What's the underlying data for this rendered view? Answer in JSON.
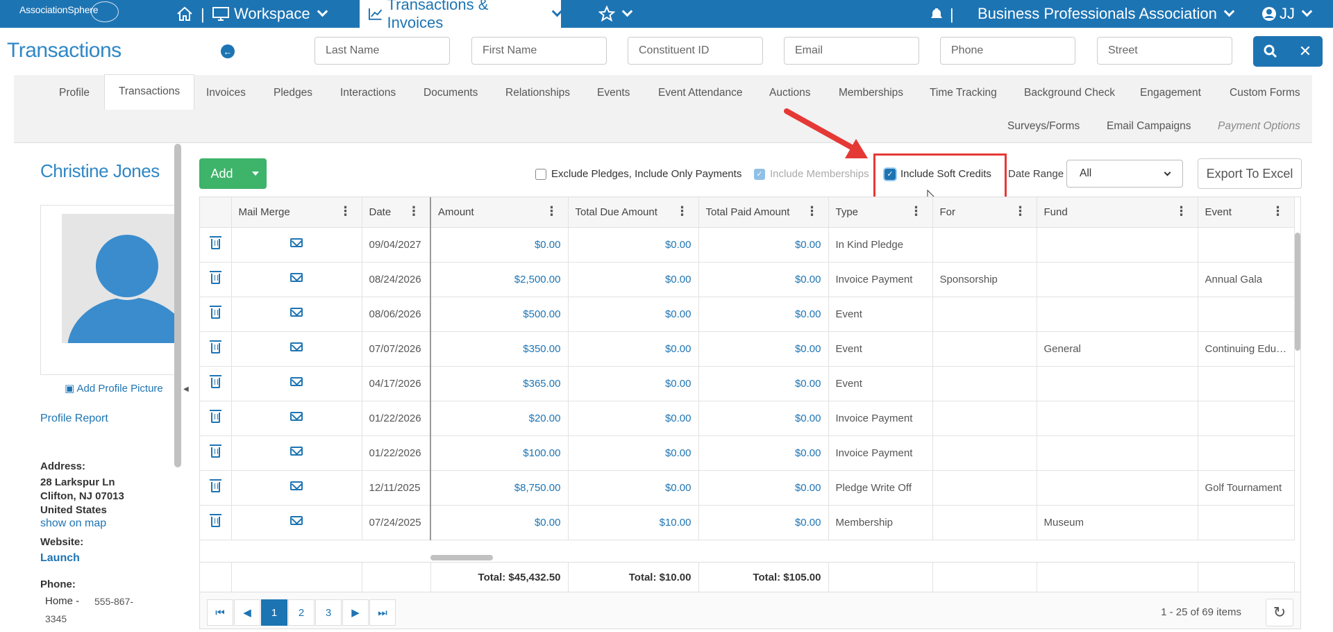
{
  "topbar": {
    "logo": "AssociationSphere",
    "sep": "|",
    "workspace": "Workspace",
    "active_tab": "Transactions & Invoices",
    "org": "Business Professionals Association",
    "user_initials": "JJ"
  },
  "header": {
    "title": "Transactions",
    "search_fields": [
      {
        "placeholder": "Last Name"
      },
      {
        "placeholder": "First Name"
      },
      {
        "placeholder": "Constituent ID"
      },
      {
        "placeholder": "Email"
      },
      {
        "placeholder": "Phone"
      },
      {
        "placeholder": "Street"
      }
    ]
  },
  "tabs": {
    "row1": [
      "Profile",
      "Transactions",
      "Invoices",
      "Pledges",
      "Interactions",
      "Documents",
      "Relationships",
      "Events",
      "Event Attendance",
      "Auctions",
      "Memberships",
      "Time Tracking",
      "Background Check",
      "Engagement",
      "Custom Forms"
    ],
    "row2": [
      "Surveys/Forms",
      "Email Campaigns",
      "Payment Options"
    ]
  },
  "profile": {
    "name": "Christine Jones",
    "add_picture": "Add Profile Picture",
    "report": "Profile Report",
    "address_label": "Address:",
    "address_line1": "28 Larkspur Ln",
    "address_line2": "Clifton, NJ 07013",
    "address_line3": "United States",
    "show_on_map": "show on map",
    "website_label": "Website:",
    "website_link": "Launch",
    "phone_label": "Phone:",
    "phone_type": "Home -",
    "phone_part1": "555-867-",
    "phone_part2": "3345"
  },
  "toolbar": {
    "add_label": "Add",
    "exclude_pledges": "Exclude Pledges, Include Only Payments",
    "include_memberships": "Include Memberships",
    "include_soft_credits": "Include Soft Credits",
    "date_range_label": "Date Range",
    "date_range_value": "All",
    "export_label": "Export To Excel"
  },
  "grid": {
    "columns": [
      "Mail Merge",
      "Date",
      "Amount",
      "Total Due Amount",
      "Total Paid Amount",
      "Type",
      "For",
      "Fund",
      "Event"
    ],
    "rows": [
      {
        "date": "09/04/2027",
        "amount": "$0.00",
        "due": "$0.00",
        "paid": "$0.00",
        "type": "In Kind Pledge",
        "for": "",
        "fund": "",
        "event": ""
      },
      {
        "date": "08/24/2026",
        "amount": "$2,500.00",
        "due": "$0.00",
        "paid": "$0.00",
        "type": "Invoice Payment",
        "for": "Sponsorship",
        "fund": "",
        "event": "Annual Gala"
      },
      {
        "date": "08/06/2026",
        "amount": "$500.00",
        "due": "$0.00",
        "paid": "$0.00",
        "type": "Event",
        "for": "",
        "fund": "",
        "event": ""
      },
      {
        "date": "07/07/2026",
        "amount": "$350.00",
        "due": "$0.00",
        "paid": "$0.00",
        "type": "Event",
        "for": "",
        "fund": "General",
        "event": "Continuing Educa..."
      },
      {
        "date": "04/17/2026",
        "amount": "$365.00",
        "due": "$0.00",
        "paid": "$0.00",
        "type": "Event",
        "for": "",
        "fund": "",
        "event": ""
      },
      {
        "date": "01/22/2026",
        "amount": "$20.00",
        "due": "$0.00",
        "paid": "$0.00",
        "type": "Invoice Payment",
        "for": "",
        "fund": "",
        "event": ""
      },
      {
        "date": "01/22/2026",
        "amount": "$100.00",
        "due": "$0.00",
        "paid": "$0.00",
        "type": "Invoice Payment",
        "for": "",
        "fund": "",
        "event": ""
      },
      {
        "date": "12/11/2025",
        "amount": "$8,750.00",
        "due": "$0.00",
        "paid": "$0.00",
        "type": "Pledge Write Off",
        "for": "",
        "fund": "",
        "event": "Golf Tournament"
      },
      {
        "date": "07/24/2025",
        "amount": "$0.00",
        "due": "$10.00",
        "paid": "$0.00",
        "type": "Membership",
        "for": "",
        "fund": "Museum",
        "event": ""
      }
    ],
    "totals": {
      "amount": "Total: $45,432.50",
      "due": "Total: $10.00",
      "paid": "Total: $105.00"
    }
  },
  "pager": {
    "pages": [
      "1",
      "2",
      "3"
    ],
    "current": "1",
    "info": "1 - 25 of 69 items"
  },
  "colors": {
    "brand": "#1d74b3",
    "add_button": "#3eb36a",
    "highlight": "#e53935"
  }
}
